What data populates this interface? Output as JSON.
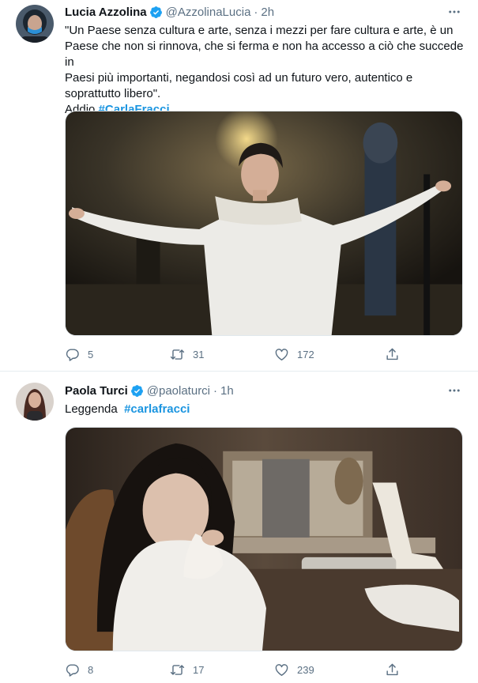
{
  "tweets": [
    {
      "name": "Lucia Azzolina",
      "handle": "@AzzolinaLucia",
      "dot": "·",
      "time": "2h",
      "text_lines": [
        "\"Un Paese senza cultura e arte, senza i mezzi per fare cultura e arte, è un",
        "Paese che non si rinnova, che si ferma e non ha accesso a ciò che succede in",
        "Paesi più importanti, negandosi così ad un futuro vero, autentico e",
        "soprattutto libero\"."
      ],
      "text_prefix": "Addio ",
      "hashtag": "#CarlaFracci",
      "replies": "5",
      "retweets": "31",
      "likes": "172"
    },
    {
      "name": "Paola Turci",
      "handle": "@paolaturci",
      "dot": "·",
      "time": "1h",
      "text_prefix": "Leggenda  ",
      "hashtag": "#carlafracci",
      "replies": "8",
      "retweets": "17",
      "likes": "239"
    }
  ],
  "icons": {
    "verified": "verified-badge-icon",
    "more": "more-icon",
    "reply": "reply-icon",
    "retweet": "retweet-icon",
    "like": "like-icon",
    "share": "share-icon"
  },
  "colors": {
    "accent": "#1b95e0",
    "secondary_text": "#5b7083",
    "divider": "#e6ecf0"
  }
}
